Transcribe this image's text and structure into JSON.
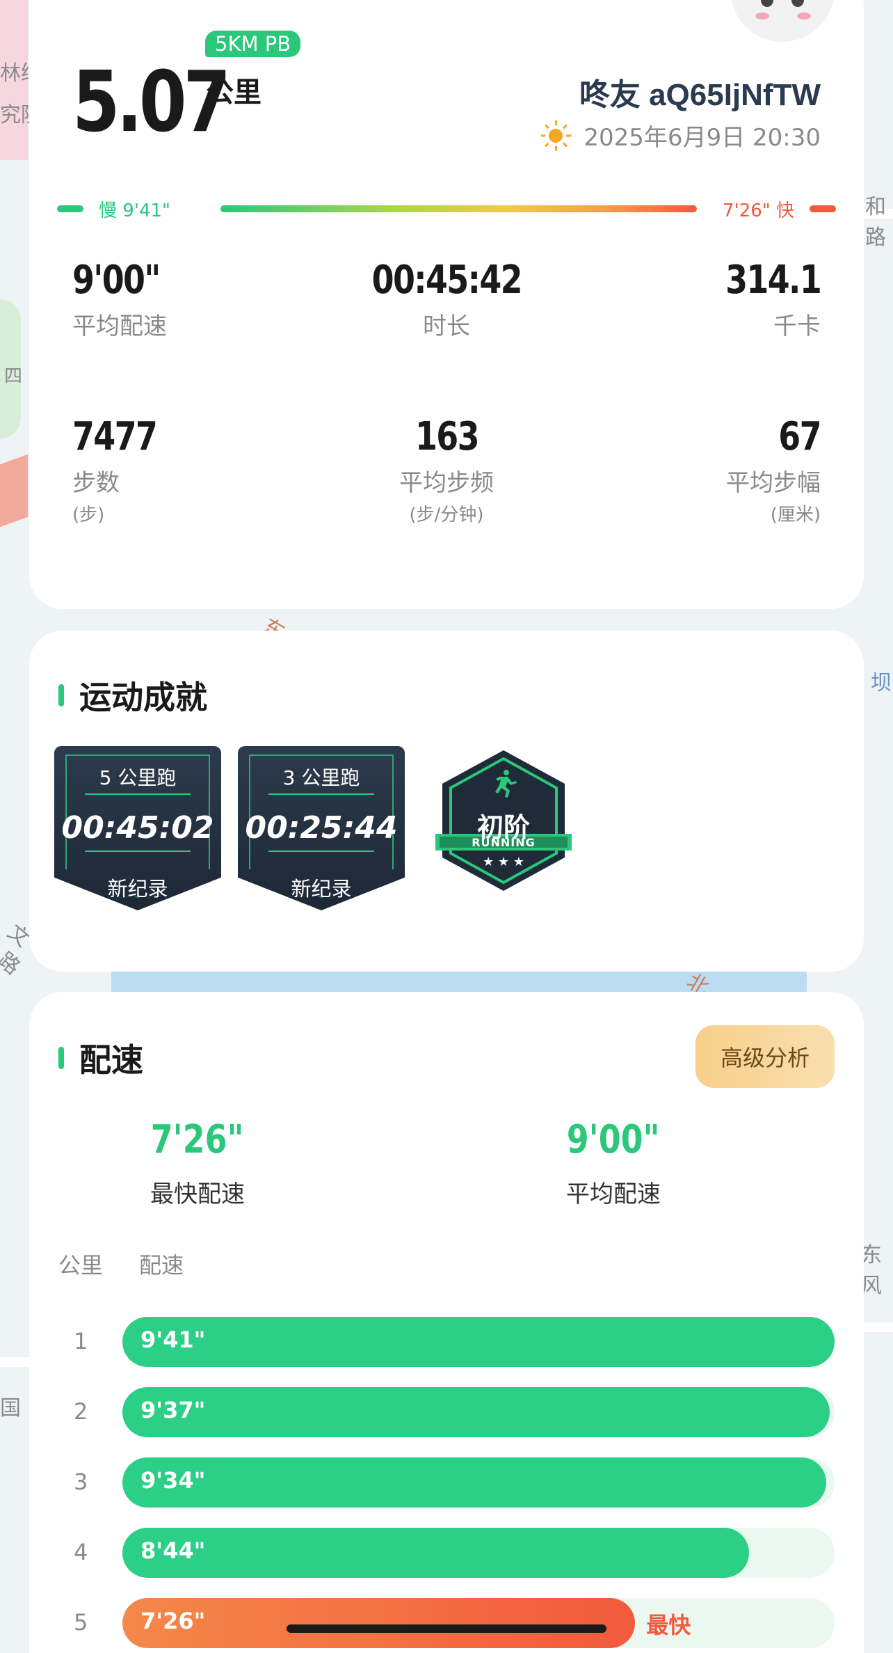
{
  "colors": {
    "accent_green": "#2bc77b",
    "accent_red": "#f25a3c",
    "advanced_button_bg": "#f7cf8a"
  },
  "map": {
    "labels": [
      "林绿",
      "究院",
      "四",
      "东",
      "坝",
      "和路",
      "文",
      "路",
      "北",
      "东风",
      "国"
    ]
  },
  "summary": {
    "distance_value": "5.07",
    "distance_unit": "公里",
    "pb_badge": "5KM PB",
    "username": "咚友 aQ65IjNfTW",
    "date_time": "2025年6月9日 20:30",
    "weather_icon": "sun-icon",
    "pace_scale": {
      "slow_label": "慢 9'41\"",
      "fast_label": "7'26\" 快"
    },
    "stats": [
      {
        "value": "9'00\"",
        "label": "平均配速",
        "unit": ""
      },
      {
        "value": "00:45:42",
        "label": "时长",
        "unit": ""
      },
      {
        "value": "314.1",
        "label": "千卡",
        "unit": ""
      },
      {
        "value": "7477",
        "label": "步数",
        "unit": "(步)"
      },
      {
        "value": "163",
        "label": "平均步频",
        "unit": "(步/分钟)"
      },
      {
        "value": "67",
        "label": "平均步幅",
        "unit": "(厘米)"
      }
    ]
  },
  "achievements": {
    "title": "运动成就",
    "badges": [
      {
        "title": "5 公里跑",
        "time": "00:45:02",
        "note": "新纪录"
      },
      {
        "title": "3 公里跑",
        "time": "00:25:44",
        "note": "新纪录"
      }
    ],
    "level_badge": {
      "title": "初阶",
      "subtitle": "RUNNING",
      "stars": "★ ★ ★"
    }
  },
  "pace": {
    "title": "配速",
    "advanced_button": "高级分析",
    "fastest": {
      "value": "7'26\"",
      "label": "最快配速"
    },
    "average": {
      "value": "9'00\"",
      "label": "平均配速"
    },
    "columns": {
      "km": "公里",
      "pace": "配速"
    },
    "splits": [
      {
        "km": "1",
        "pace": "9'41\"",
        "relative": 1.0
      },
      {
        "km": "2",
        "pace": "9'37\"",
        "relative": 0.993
      },
      {
        "km": "3",
        "pace": "9'34\"",
        "relative": 0.988
      },
      {
        "km": "4",
        "pace": "8'44\"",
        "relative": 0.88
      },
      {
        "km": "5",
        "pace": "7'26\"",
        "relative": 0.72,
        "tag": "最快"
      }
    ]
  }
}
